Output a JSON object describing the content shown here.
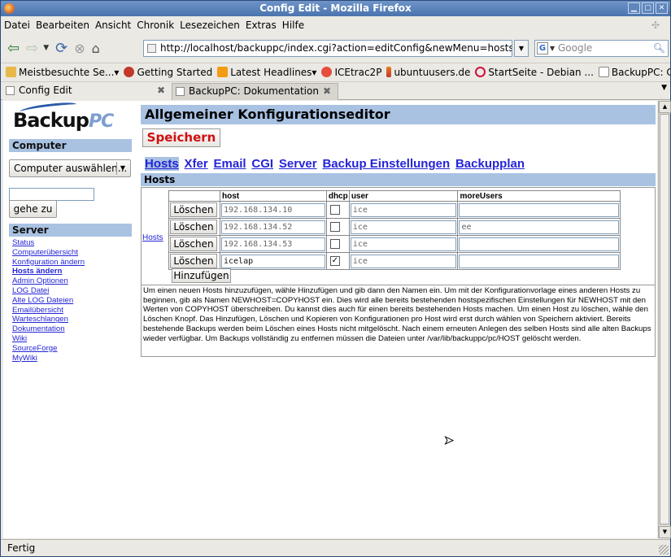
{
  "window": {
    "title": "Config Edit - Mozilla Firefox"
  },
  "menu": [
    "Datei",
    "Bearbeiten",
    "Ansicht",
    "Chronik",
    "Lesezeichen",
    "Extras",
    "Hilfe"
  ],
  "address": {
    "url": "http://localhost/backuppc/index.cgi?action=editConfig&newMenu=hosts"
  },
  "search": {
    "placeholder": "Google",
    "engine_letter": "G"
  },
  "bookmarks": [
    "Meistbesuchte Se...▾",
    "Getting Started",
    "Latest Headlines▾",
    "ICEtrac2P",
    "ubuntuusers.de",
    "StartSeite - Debian ...",
    "BackupPC: Compute..."
  ],
  "tabs": [
    {
      "label": "Config Edit",
      "active": true
    },
    {
      "label": "BackupPC: Dokumentation",
      "active": false
    }
  ],
  "logo": {
    "text": "Backup",
    "suffix": "PC"
  },
  "sidebar": {
    "computer_heading": "Computer",
    "host_select": "Computer auswählen...",
    "goto_button": "gehe zu",
    "server_heading": "Server",
    "links": [
      {
        "label": "Status",
        "current": false
      },
      {
        "label": "Computerübersicht",
        "current": false
      },
      {
        "label": "Konfiguration ändern",
        "current": false
      },
      {
        "label": "Hosts ändern",
        "current": true
      },
      {
        "label": "Admin Optionen",
        "current": false
      },
      {
        "label": "LOG Datei",
        "current": false
      },
      {
        "label": "Alte LOG Dateien",
        "current": false
      },
      {
        "label": "Emailübersicht",
        "current": false
      },
      {
        "label": "Warteschlangen",
        "current": false
      },
      {
        "label": "Dokumentation",
        "current": false
      },
      {
        "label": "Wiki",
        "current": false
      },
      {
        "label": "SourceForge",
        "current": false
      },
      {
        "label": "MyWiki",
        "current": false
      }
    ]
  },
  "main": {
    "title": "Allgemeiner Konfigurationseditor",
    "save_button": "Speichern",
    "menu_tabs": [
      "Hosts",
      "Xfer",
      "Email",
      "CGI",
      "Server",
      "Backup Einstellungen",
      "Backupplan"
    ],
    "section_heading": "Hosts",
    "hosts_link": "Hosts",
    "columns": [
      "host",
      "dhcp",
      "user",
      "moreUsers"
    ],
    "delete_label": "Löschen",
    "add_button": "Hinzufügen",
    "rows": [
      {
        "host": "192.168.134.10",
        "dhcp": false,
        "user": "ice",
        "moreUsers": ""
      },
      {
        "host": "192.168.134.52",
        "dhcp": false,
        "user": "ice",
        "moreUsers": "ee"
      },
      {
        "host": "192.168.134.53",
        "dhcp": false,
        "user": "ice",
        "moreUsers": ""
      },
      {
        "host": "icelap",
        "dhcp": true,
        "user": "ice",
        "moreUsers": ""
      }
    ],
    "help": "Um einen neuen Hosts hinzuzufügen, wähle Hinzufügen und gib dann den Namen ein. Um mit der Konfigurationvorlage eines anderen Hosts zu beginnen, gib als Namen NEWHOST=COPYHOST ein. Dies wird alle bereits bestehenden hostspezifischen Einstellungen für NEWHOST mit den Werten von COPYHOST überschreiben. Du kannst dies auch für einen bereits bestehenden Hosts machen. Um einen Host zu löschen, wähle den Löschen Knopf. Das Hinzufügen, Löschen und Kopieren von Konfigurationen pro Host wird erst durch wählen von Speichern aktiviert. Bereits bestehende Backups werden beim Löschen eines Hosts nicht mitgelöscht. Nach einem erneuten Anlegen des selben Hosts sind alle alten Backups wieder verfügbar. Um Backups vollständig zu entfernen müssen die Dateien unter /var/lib/backuppc/pc/HOST gelöscht werden."
  },
  "status": "Fertig"
}
